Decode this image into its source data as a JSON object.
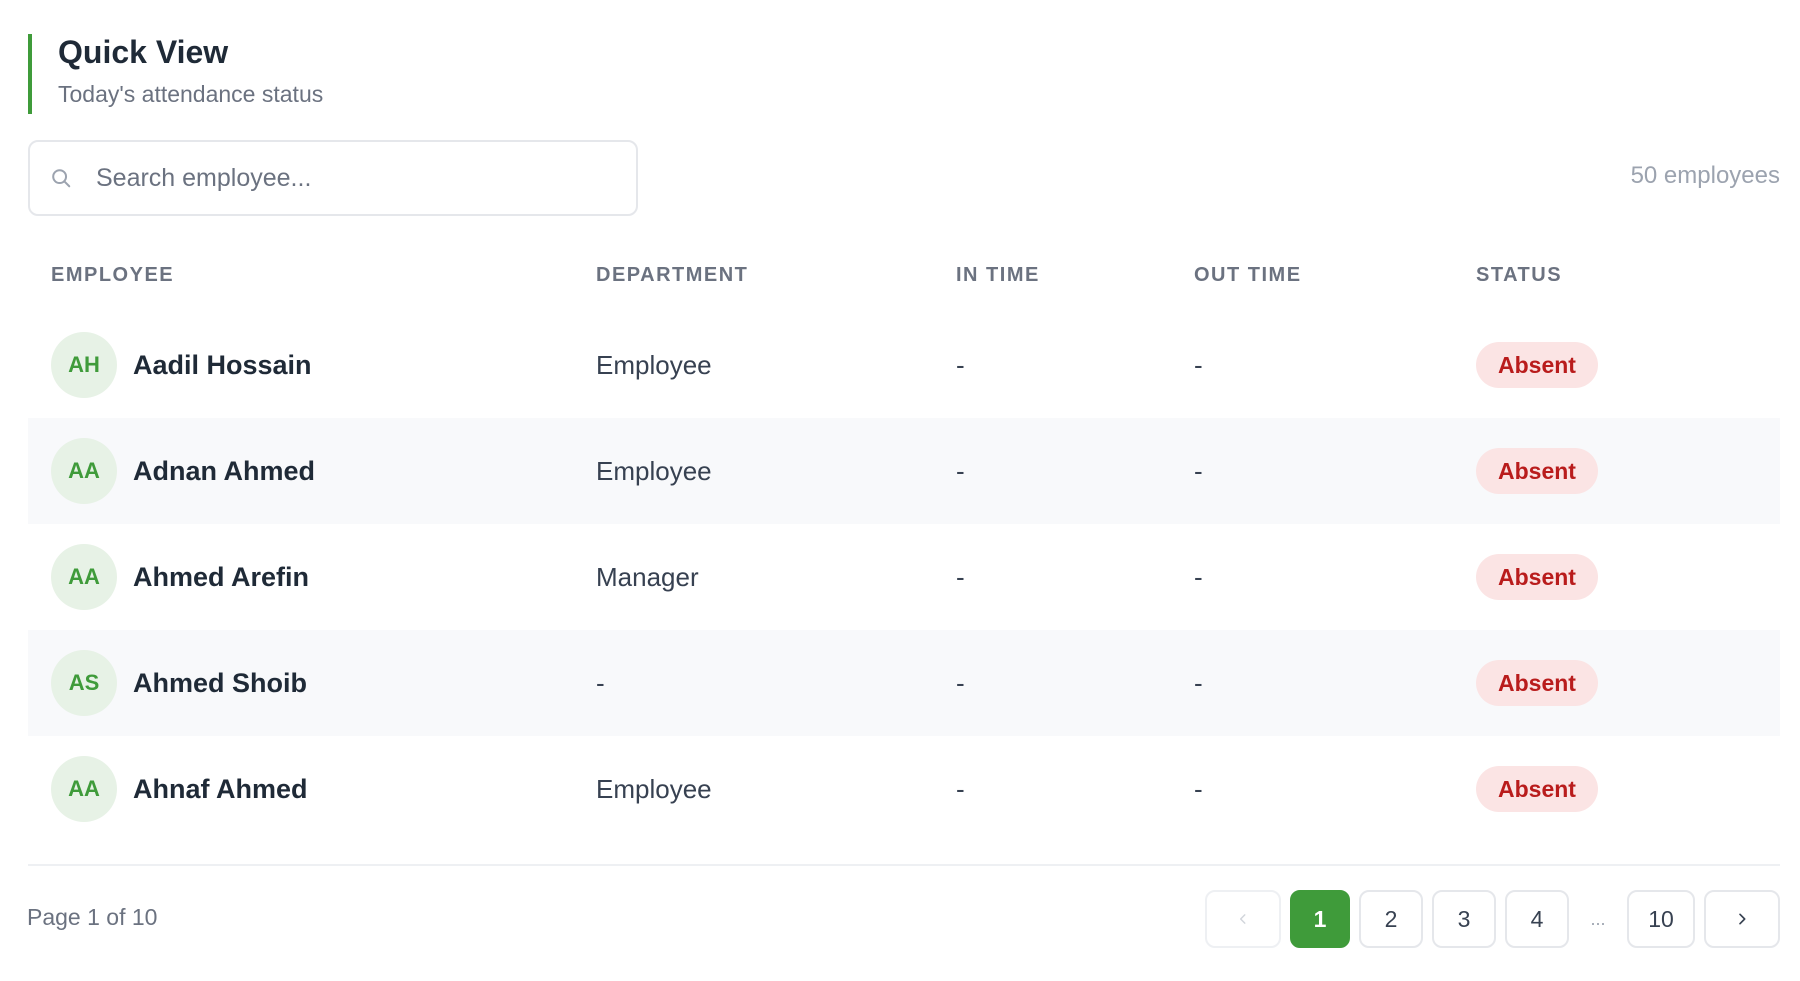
{
  "header": {
    "title": "Quick View",
    "subtitle": "Today's attendance status"
  },
  "search": {
    "placeholder": "Search employee...",
    "value": ""
  },
  "employee_count": "50 employees",
  "table": {
    "columns": [
      "EMPLOYEE",
      "DEPARTMENT",
      "IN TIME",
      "OUT TIME",
      "STATUS"
    ],
    "rows": [
      {
        "initials": "AH",
        "name": "Aadil Hossain",
        "department": "Employee",
        "in_time": "-",
        "out_time": "-",
        "status": "Absent"
      },
      {
        "initials": "AA",
        "name": "Adnan Ahmed",
        "department": "Employee",
        "in_time": "-",
        "out_time": "-",
        "status": "Absent"
      },
      {
        "initials": "AA",
        "name": "Ahmed Arefin",
        "department": "Manager",
        "in_time": "-",
        "out_time": "-",
        "status": "Absent"
      },
      {
        "initials": "AS",
        "name": "Ahmed Shoib",
        "department": "-",
        "in_time": "-",
        "out_time": "-",
        "status": "Absent"
      },
      {
        "initials": "AA",
        "name": "Ahnaf Ahmed",
        "department": "Employee",
        "in_time": "-",
        "out_time": "-",
        "status": "Absent"
      }
    ]
  },
  "pagination": {
    "info": "Page 1 of 10",
    "prev_icon": "chevron-left-icon",
    "next_icon": "chevron-right-icon",
    "pages": [
      "1",
      "2",
      "3",
      "4"
    ],
    "ellipsis": "...",
    "last": "10",
    "current": "1"
  },
  "colors": {
    "accent": "#3f9b3a",
    "absent_bg": "#fbe4e4",
    "absent_text": "#b91c1c"
  }
}
